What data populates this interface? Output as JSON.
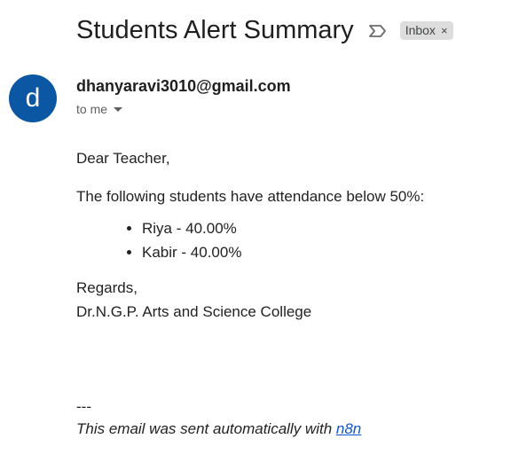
{
  "email": {
    "subject": "Students Alert Summary",
    "label": "Inbox",
    "label_remove": "×",
    "importance_icon": "importance-marker-icon",
    "sender": {
      "avatar_letter": "d",
      "avatar_color": "#0b57a4",
      "address": "dhanyaravi3010@gmail.com"
    },
    "recipient": "to me"
  },
  "body": {
    "greeting": "Dear Teacher,",
    "intro": "The following students have attendance below 50%:",
    "students": [
      "Riya - 40.00%",
      "Kabir - 40.00%"
    ],
    "closing": "Regards,",
    "signature": "Dr.N.G.P. Arts and Science College",
    "divider": "---",
    "footer_text": "This email was sent automatically with ",
    "footer_link": "n8n",
    "link_color": "#1155cc"
  }
}
